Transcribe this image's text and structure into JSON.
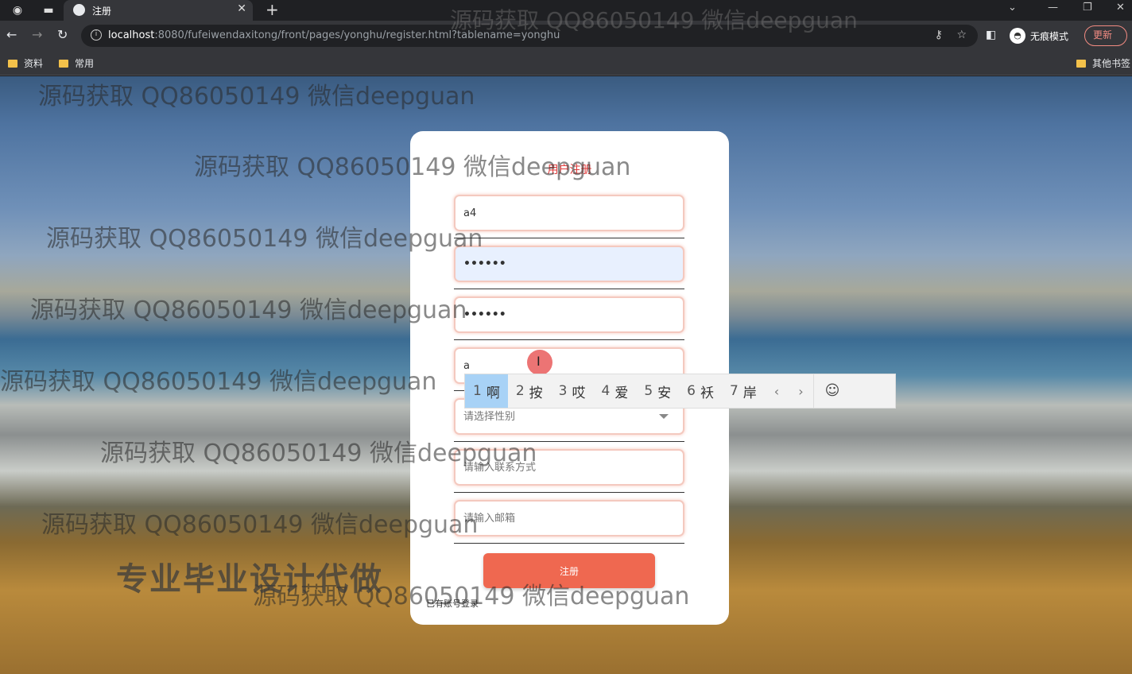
{
  "browser": {
    "tab_title": "注册",
    "new_tab": "+",
    "url_host": "localhost",
    "url_rest": ":8080/fufeiwendaxitong/front/pages/yonghu/register.html?tablename=yonghu",
    "incognito_label": "无痕模式",
    "update_label": "更新",
    "bookmarks": [
      "资料",
      "常用"
    ],
    "other_bookmarks": "其他书签"
  },
  "watermark": {
    "text": "源码获取 QQ86050149 微信deepguan",
    "promo": "专业毕业设计代做"
  },
  "form": {
    "title": "用户注册",
    "account_value": "a4",
    "password_value": "••••••",
    "confirm_password_value": "••••••",
    "name_value": "a",
    "gender_placeholder": "请选择性别",
    "phone_placeholder": "请输入联系方式",
    "email_placeholder": "请输入邮箱",
    "submit_label": "注册",
    "login_link": "已有账号登录"
  },
  "ime": {
    "candidates": [
      {
        "num": "1",
        "char": "啊"
      },
      {
        "num": "2",
        "char": "按"
      },
      {
        "num": "3",
        "char": "哎"
      },
      {
        "num": "4",
        "char": "爱"
      },
      {
        "num": "5",
        "char": "安"
      },
      {
        "num": "6",
        "char": "袄"
      },
      {
        "num": "7",
        "char": "岸"
      }
    ],
    "prev": "‹",
    "next": "›",
    "emoji": "☺"
  }
}
